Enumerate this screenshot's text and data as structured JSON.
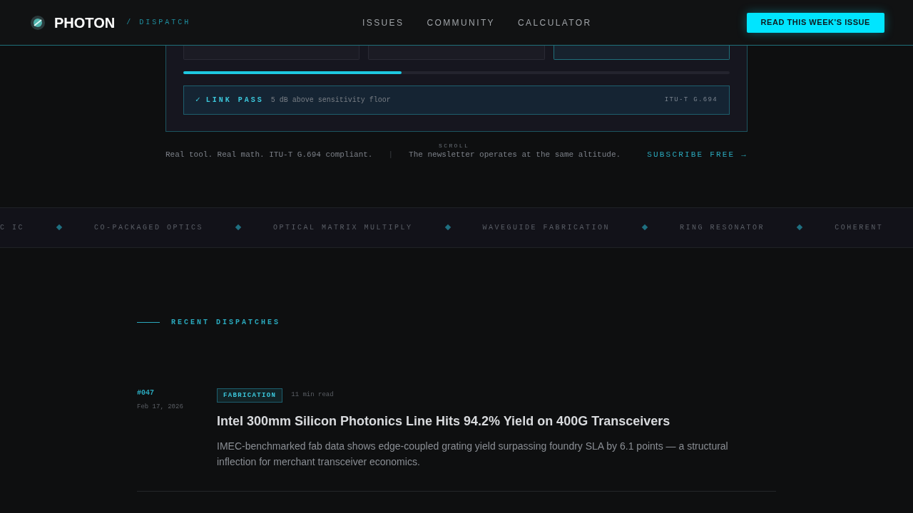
{
  "header": {
    "brand": "PHOTON",
    "section": "/ DISPATCH",
    "nav": [
      {
        "label": "ISSUES"
      },
      {
        "label": "COMMUNITY"
      },
      {
        "label": "CALCULATOR"
      }
    ],
    "cta": "READ THIS WEEK'S ISSUE"
  },
  "calculator": {
    "cards": [
      {
        "selected": false
      },
      {
        "selected": false
      },
      {
        "selected": true
      }
    ],
    "margin": {
      "level": 0.4
    },
    "result": {
      "pass": true,
      "mark": "✓",
      "status": "LINK PASS",
      "detail": "5 dB above sensitivity floor",
      "standard": "ITU-T G.694"
    }
  },
  "tagline": {
    "left": "Real tool. Real math. ITU-T G.694 compliant.",
    "separator": "|",
    "right": "The newsletter operates at the same altitude.",
    "link": "SUBSCRIBE FREE →",
    "scroll_hint": "SCROLL"
  },
  "ticker": [
    "C IC",
    "CO-PACKAGED OPTICS",
    "OPTICAL MATRIX MULTIPLY",
    "WAVEGUIDE FABRICATION",
    "RING RESONATOR",
    "COHERENT"
  ],
  "recent": {
    "heading": "RECENT DISPATCHES",
    "items": [
      {
        "number": "#047",
        "date": "Feb 17, 2026",
        "tag": "FABRICATION",
        "read_time": "11 min read",
        "title": "Intel 300mm Silicon Photonics Line Hits 94.2% Yield on 400G Transceivers",
        "summary": "IMEC-benchmarked fab data shows edge-coupled grating yield surpassing foundry SLA by 6.1 points — a structural inflection for merchant transceiver economics."
      }
    ]
  }
}
